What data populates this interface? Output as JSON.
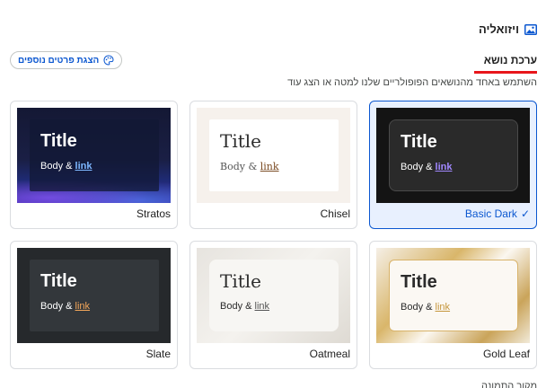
{
  "header": {
    "title": "ויזואליה",
    "icon": "image-icon"
  },
  "more_details_button": {
    "label": "הצגת פרטים נוספים",
    "icon": "palette-icon"
  },
  "tab": {
    "label": "ערכת נושא",
    "underline_color": "#e8161b"
  },
  "description": "השתמש באחד מהנושאים הפופולריים שלנו למטה או הצג עוד",
  "preview_text": {
    "title": "Title",
    "body": "Body &",
    "link": "link"
  },
  "themes": [
    {
      "name": "Stratos",
      "selected": false
    },
    {
      "name": "Chisel",
      "selected": false
    },
    {
      "name": "Basic Dark",
      "selected": true
    },
    {
      "name": "Slate",
      "selected": false
    },
    {
      "name": "Oatmeal",
      "selected": false
    },
    {
      "name": "Gold Leaf",
      "selected": false
    }
  ],
  "bottom_partial_label": "מקור התמונה",
  "colors": {
    "accent": "#0b57d0",
    "selected_bg": "#e8f0fe"
  }
}
